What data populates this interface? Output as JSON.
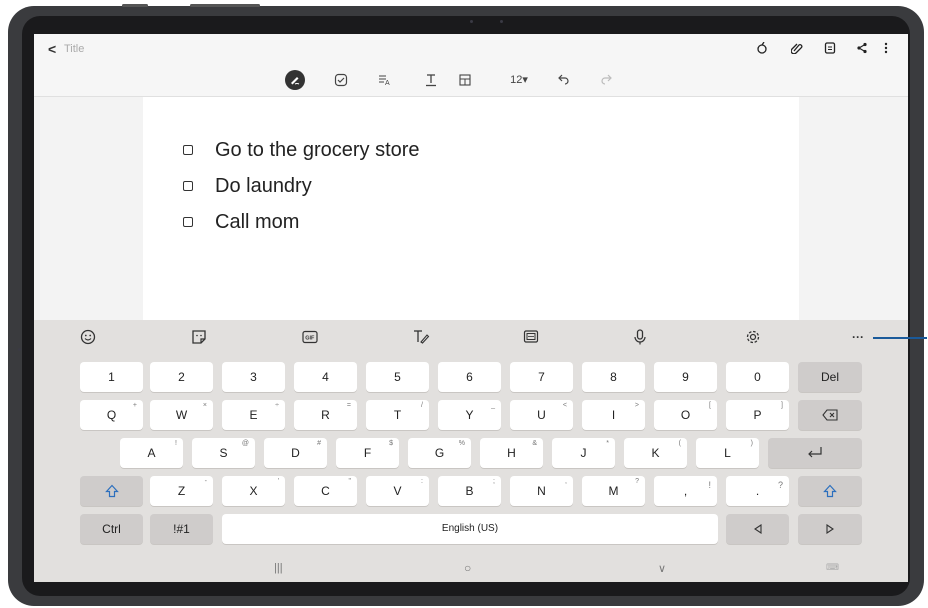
{
  "title_bar": {
    "back_glyph": "<",
    "title": "Title",
    "right_icons": [
      "attach-sticker-icon",
      "paperclip-icon",
      "page-icon",
      "share-icon",
      "more-vert-icon"
    ]
  },
  "toolbar": {
    "font_size": "12▾",
    "icons": [
      "handwriting-pen-icon",
      "checkbox-icon",
      "text-style-icon",
      "text-color-icon",
      "table-icon",
      "undo-icon",
      "redo-icon"
    ]
  },
  "note": {
    "items": [
      "Go to the grocery store",
      "Do laundry",
      "Call mom"
    ]
  },
  "keyboard": {
    "tools": [
      "emoji-icon",
      "sticker-icon",
      "gif-icon",
      "handwriting-icon",
      "clipboard-icon",
      "mic-icon",
      "settings-icon",
      "more-icon"
    ],
    "more_label": "···",
    "number_row": [
      "1",
      "2",
      "3",
      "4",
      "5",
      "6",
      "7",
      "8",
      "9",
      "0"
    ],
    "del_label": "Del",
    "q_row": [
      {
        "k": "Q",
        "s": "+"
      },
      {
        "k": "W",
        "s": "×"
      },
      {
        "k": "E",
        "s": "÷"
      },
      {
        "k": "R",
        "s": "="
      },
      {
        "k": "T",
        "s": "/"
      },
      {
        "k": "Y",
        "s": "_"
      },
      {
        "k": "U",
        "s": "<"
      },
      {
        "k": "I",
        "s": ">"
      },
      {
        "k": "O",
        "s": "["
      },
      {
        "k": "P",
        "s": "]"
      }
    ],
    "a_row": [
      {
        "k": "A",
        "s": "!"
      },
      {
        "k": "S",
        "s": "@"
      },
      {
        "k": "D",
        "s": "#"
      },
      {
        "k": "F",
        "s": "$"
      },
      {
        "k": "G",
        "s": "%"
      },
      {
        "k": "H",
        "s": "&"
      },
      {
        "k": "J",
        "s": "*"
      },
      {
        "k": "K",
        "s": "("
      },
      {
        "k": "L",
        "s": ")"
      }
    ],
    "z_row": [
      {
        "k": "Z",
        "s": "-"
      },
      {
        "k": "X",
        "s": "'"
      },
      {
        "k": "C",
        "s": "\""
      },
      {
        "k": "V",
        "s": ":"
      },
      {
        "k": "B",
        "s": ";"
      },
      {
        "k": "N",
        "s": ","
      },
      {
        "k": "M",
        "s": "?"
      }
    ],
    "comma_label": ",",
    "comma_sup": "!",
    "period_label": ".",
    "period_sup": "?",
    "ctrl_label": "Ctrl",
    "sym_label": "!#1",
    "space_label": "English (US)"
  },
  "nav": {
    "recent": "|||",
    "home": "○",
    "back": "∨",
    "kbd": "⌨"
  }
}
